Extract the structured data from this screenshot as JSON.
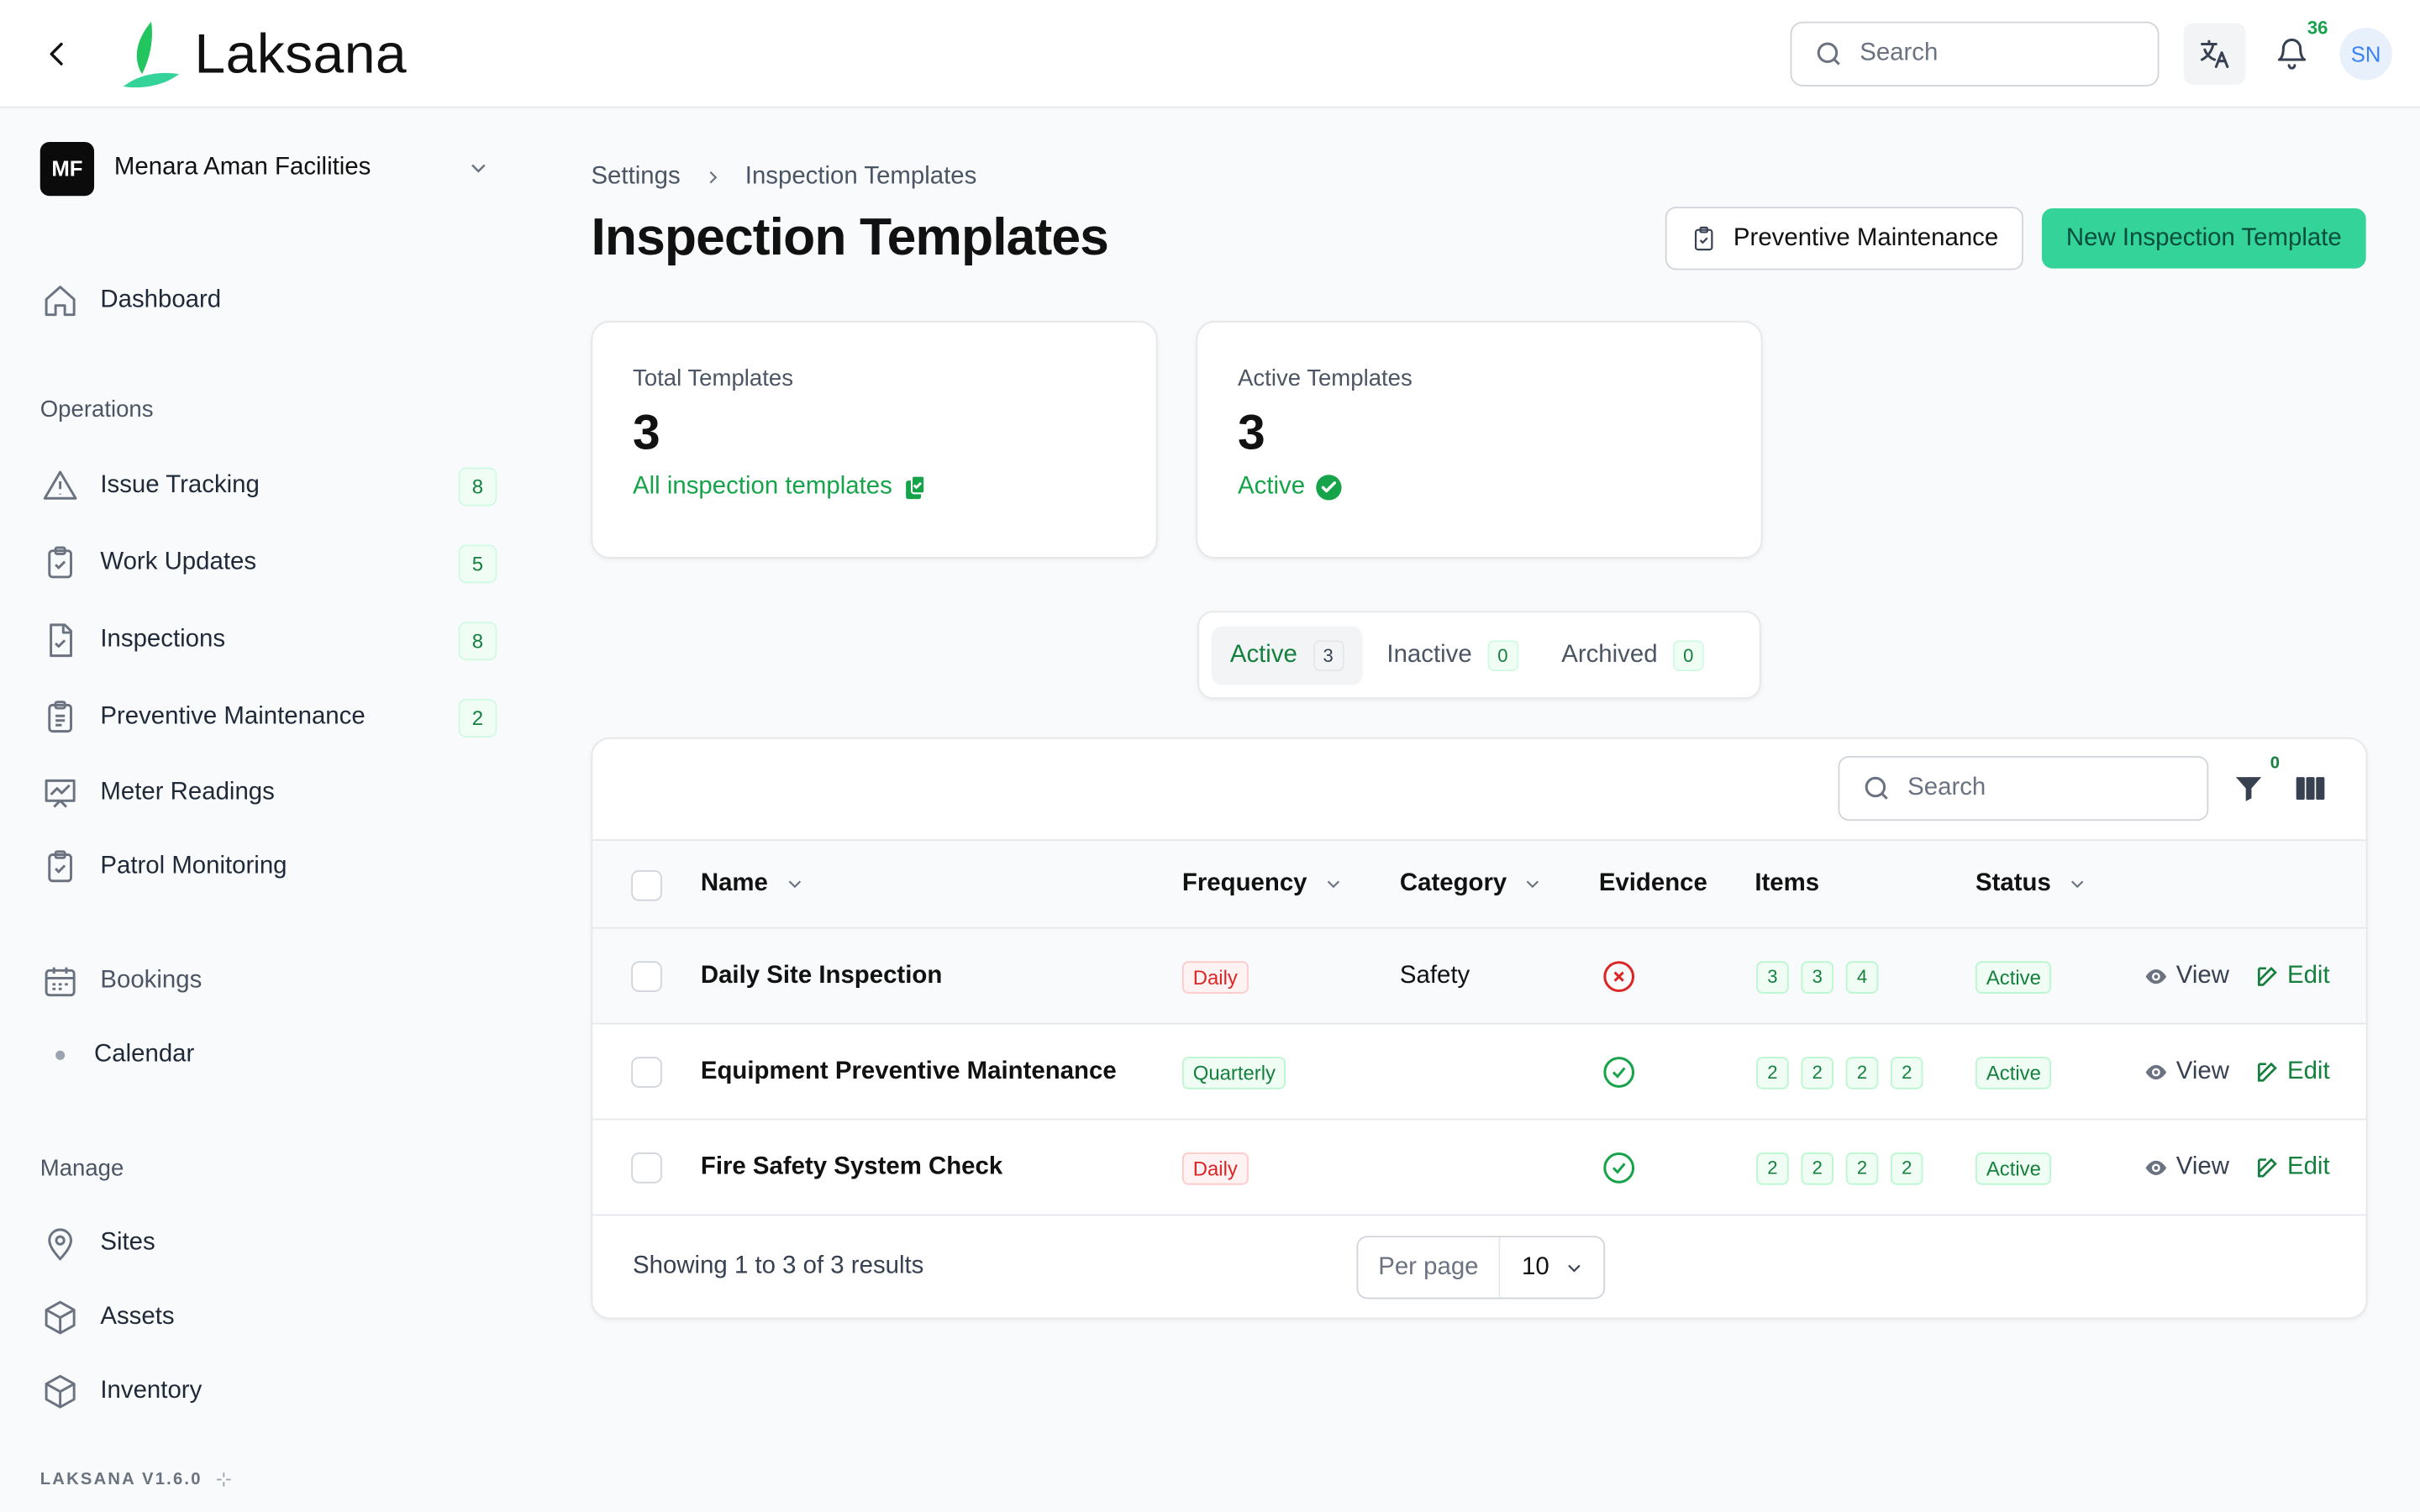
{
  "app": {
    "logo_text": "Laksana",
    "version": "LAKSANA V1.6.0"
  },
  "topbar": {
    "search_placeholder": "Search",
    "notification_count": "36",
    "avatar_initials": "SN"
  },
  "sidebar": {
    "org": {
      "initials": "MF",
      "name": "Menara Aman Facilities"
    },
    "dashboard": "Dashboard",
    "sections": {
      "operations": "Operations",
      "manage": "Manage"
    },
    "operations_items": [
      {
        "label": "Issue Tracking",
        "badge": "8",
        "icon": "warning-icon"
      },
      {
        "label": "Work Updates",
        "badge": "5",
        "icon": "clipboard-check-icon"
      },
      {
        "label": "Inspections",
        "badge": "8",
        "icon": "document-check-icon"
      },
      {
        "label": "Preventive Maintenance",
        "badge": "2",
        "icon": "clipboard-list-icon"
      },
      {
        "label": "Meter Readings",
        "badge": "",
        "icon": "chart-board-icon"
      },
      {
        "label": "Patrol Monitoring",
        "badge": "",
        "icon": "clipboard-check-icon"
      }
    ],
    "bookings": "Bookings",
    "calendar": "Calendar",
    "manage_items": [
      {
        "label": "Sites",
        "icon": "map-pin-icon"
      },
      {
        "label": "Assets",
        "icon": "cube-icon"
      },
      {
        "label": "Inventory",
        "icon": "cube-icon"
      }
    ]
  },
  "breadcrumb": {
    "parent": "Settings",
    "current": "Inspection Templates"
  },
  "page": {
    "title": "Inspection Templates",
    "btn_preventive": "Preventive Maintenance",
    "btn_new": "New Inspection Template"
  },
  "stats": {
    "total": {
      "label": "Total Templates",
      "value": "3",
      "sub": "All inspection templates"
    },
    "active": {
      "label": "Active Templates",
      "value": "3",
      "sub": "Active"
    }
  },
  "tabs": [
    {
      "label": "Active",
      "count": "3"
    },
    {
      "label": "Inactive",
      "count": "0"
    },
    {
      "label": "Archived",
      "count": "0"
    }
  ],
  "table": {
    "search_placeholder": "Search",
    "filter_count": "0",
    "headers": {
      "name": "Name",
      "frequency": "Frequency",
      "category": "Category",
      "evidence": "Evidence",
      "items": "Items",
      "status": "Status"
    },
    "rows": [
      {
        "name": "Daily Site Inspection",
        "frequency": "Daily",
        "category": "Safety",
        "evidence": false,
        "items": [
          "3",
          "3",
          "4"
        ],
        "status": "Active"
      },
      {
        "name": "Equipment Preventive Maintenance",
        "frequency": "Quarterly",
        "category": "",
        "evidence": true,
        "items": [
          "2",
          "2",
          "2",
          "2"
        ],
        "status": "Active"
      },
      {
        "name": "Fire Safety System Check",
        "frequency": "Daily",
        "category": "",
        "evidence": true,
        "items": [
          "2",
          "2",
          "2",
          "2"
        ],
        "status": "Active"
      }
    ],
    "view_label": "View",
    "edit_label": "Edit",
    "footer_text": "Showing 1 to 3 of 3 results",
    "per_page_label": "Per page",
    "per_page_value": "10"
  },
  "colors": {
    "accent": "#34d399",
    "success": "#16a34a",
    "danger": "#dc2626"
  }
}
